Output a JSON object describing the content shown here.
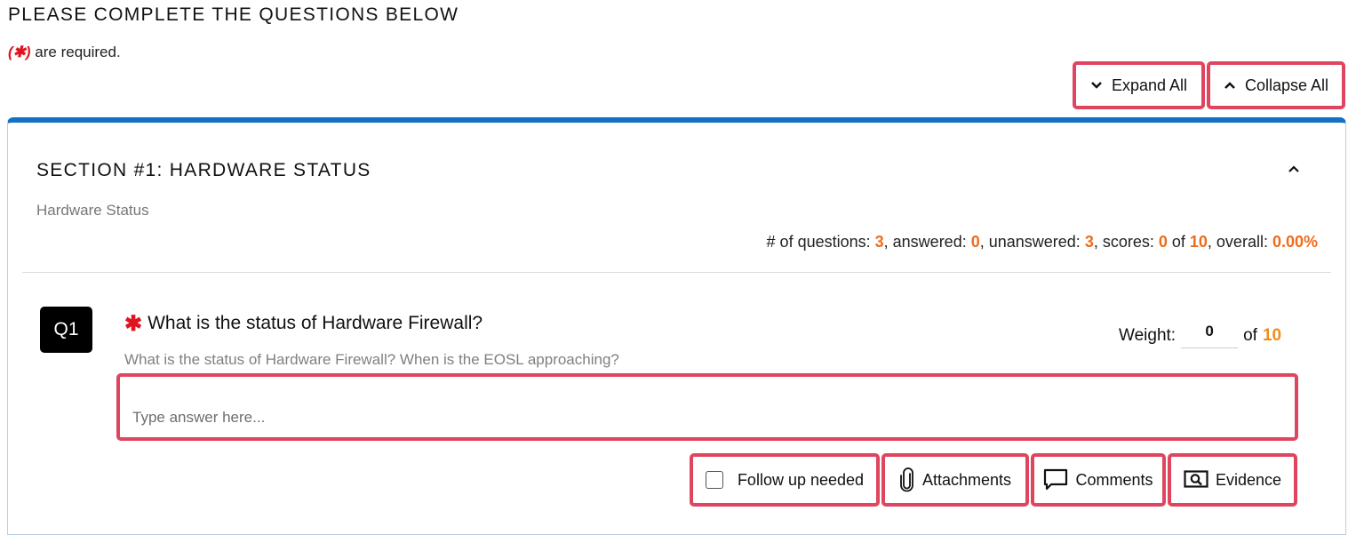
{
  "page": {
    "heading": "PLEASE COMPLETE THE QUESTIONS BELOW",
    "required_marker": "(✱)",
    "required_text": " are required."
  },
  "toolbar": {
    "expand_all": "Expand All",
    "collapse_all": "Collapse All"
  },
  "section": {
    "title": "SECTION #1: HARDWARE STATUS",
    "subtitle": "Hardware Status",
    "stats": {
      "questions_label": "# of questions: ",
      "questions": "3",
      "answered_label": ", answered: ",
      "answered": "0",
      "unanswered_label": ", unanswered: ",
      "unanswered": "3",
      "scores_label": ", scores: ",
      "score": "0",
      "of_label": " of ",
      "score_max": "10",
      "overall_label": ", overall: ",
      "overall": "0.00%"
    }
  },
  "question": {
    "badge": "Q1",
    "required_star": "✱",
    "title": "What is the status of Hardware Firewall?",
    "description": "What is the status of Hardware Firewall? When is the EOSL approaching?",
    "weight_label": "Weight:",
    "weight_value": "0",
    "weight_of": "of",
    "weight_max": "10",
    "answer_placeholder": "Type answer here...",
    "actions": {
      "follow_up": "Follow up needed",
      "attachments": "Attachments",
      "comments": "Comments",
      "evidence": "Evidence"
    }
  },
  "colors": {
    "accent_blue": "#1470c3",
    "highlight": "#e0455f",
    "number_orange": "#ef6c1c",
    "required_red": "#e0141e"
  },
  "icons": {
    "expand": "chevron-down-icon",
    "collapse": "chevron-up-icon",
    "section_toggle": "chevron-up-icon",
    "attachments": "paperclip-icon",
    "comments": "comment-icon",
    "evidence": "evidence-search-icon"
  }
}
